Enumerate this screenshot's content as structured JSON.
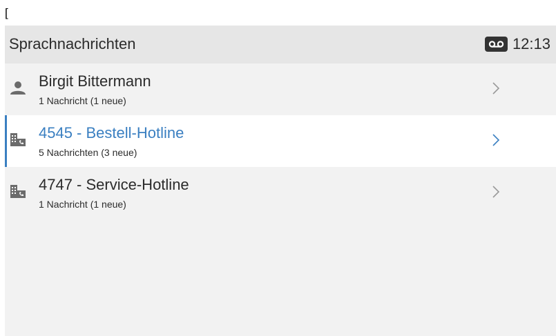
{
  "stray_char": "[",
  "header": {
    "title": "Sprachnachrichten",
    "time": "12:13",
    "status_icon": "voicemail-icon"
  },
  "colors": {
    "accent": "#3a7fc1",
    "header_bg": "#e6e6e6",
    "list_bg": "#f2f2f2",
    "text": "#2b2b2b"
  },
  "items": [
    {
      "name": "Birgit Bittermann",
      "sub": "1 Nachricht (1 neue)",
      "icon": "person-icon",
      "selected": false
    },
    {
      "name": "4545 - Bestell-Hotline",
      "sub": "5 Nachrichten (3 neue)",
      "icon": "building-phone-icon",
      "selected": true
    },
    {
      "name": "4747 - Service-Hotline",
      "sub": "1 Nachricht (1 neue)",
      "icon": "building-phone-icon",
      "selected": false
    }
  ]
}
